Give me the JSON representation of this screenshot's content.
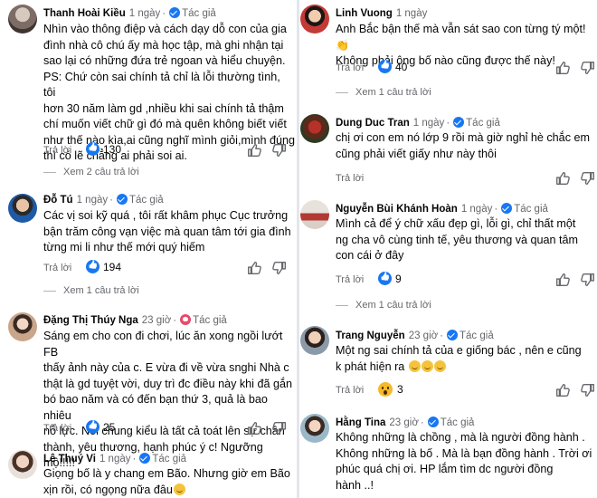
{
  "labels": {
    "reply": "Trả lời",
    "author_badge": "Tác giả"
  },
  "left": [
    {
      "name": "Thanh Hoài Kiều",
      "time": "1 ngày",
      "author": "Tác giả",
      "text": [
        "Nhìn vào thông điệp và cách dạy dỗ con của gia",
        "đình nhà cô chú ấy mà học tập, mà ghi nhận tại",
        "sao lại có những đứa trẻ ngoan và hiểu chuyện.",
        "PS: Chứ còn sai chính tả chỉ là lỗi thường tình, tôi",
        "hơn 30 năm làm gd ,nhiều khi sai chính tả thậm",
        "chí muốn viết chữ gì đó mà quên không biết viết",
        "như thế nào kìa,ai cũng nghĩ mình giỏi,mình đúng",
        "thì có lẽ chẳng ai phải soi ai."
      ],
      "reply": "Trả lời",
      "count": "130",
      "more": "Xem 2 câu trả lời"
    },
    {
      "name": "Đỗ Tú",
      "time": "1 ngày",
      "author": "Tác giả",
      "text": [
        "Các vị soi kỹ quá , tôi rất khâm phục Cục trưởng",
        "bận trăm công vạn việc mà quan tâm tới gia đình",
        "từng mi li như thế mới quý hiếm"
      ],
      "reply": "Trả lời",
      "count": "194",
      "more": "Xem 1 câu trả lời"
    },
    {
      "name": "Đặng Thị Thúy Nga",
      "time": "23 giờ",
      "author": "Tác giả",
      "text": [
        "Sáng em cho con đi chơi, lúc ăn xong ngồi lướt FB",
        "thấy ảnh này của c. E vừa đi về vừa snghi Nhà c",
        "thật là gd tuyệt vời, duy trì đc điều này khi đã gắn",
        "bó bao năm và có đến bạn thứ 3, quả là bao nhiêu",
        "nỗ lực. Nói chung kiểu là tất cả toát lên sự chân",
        "thành, yêu thương, hạnh phúc ý c! Ngưỡng mộ!!!!!"
      ],
      "reply": "Trả lời",
      "count": "25"
    },
    {
      "name": "Lê Thuý Vi",
      "time": "1 ngày",
      "author": "Tác giả",
      "text": [
        "Giọng bố là y chang em Bão. Nhưng giờ em Bão",
        "xịn rồi, có ngọng nữa đâu"
      ]
    }
  ],
  "right": [
    {
      "name": "Linh Vuong",
      "time": "1 ngày",
      "text": [
        "Anh Bắc bận thế mà vẫn sát sao con từng tý một!",
        "Không phải ông bố nào cũng được thế này!"
      ],
      "reply": "Trả lời",
      "count": "40",
      "more": "Xem 1 câu trả lời"
    },
    {
      "name": "Dung Duc Tran",
      "time": "1 ngày",
      "author": "Tác giả",
      "text": [
        "chị ơi con em nó lớp 9 rồi mà giờ nghỉ hè chắc em",
        "cũng phải viết giấy như này thôi"
      ],
      "reply": "Trả lời"
    },
    {
      "name": "Nguyễn Bùi Khánh Hoàn",
      "time": "1 ngày",
      "author": "Tác giả",
      "text": [
        "Mình cả để ý chữ xấu đẹp gì, lỗi gì, chỉ thất một",
        "ng cha vô cùng tinh tế, yêu thương và quan tâm",
        "con cái ở đây"
      ],
      "reply": "Trả lời",
      "count": "9",
      "more": "Xem 1 câu trả lời"
    },
    {
      "name": "Trang Nguyễn",
      "time": "23 giờ",
      "author": "Tác giả",
      "text": [
        "Một ng sai chính tả của e giống bác , nên e cũng",
        "k phát hiện ra"
      ],
      "reply": "Trả lời",
      "count": "3"
    },
    {
      "name": "Hằng Tina",
      "time": "23 giờ",
      "author": "Tác giả",
      "text": [
        "Không những là chồng , mà là người đồng hành .",
        "Không những là bố . Mà là bạn đồng hành . Trời ơi",
        "phúc quá chị ơi. HP lắm tìm dc người đồng",
        "hành ..!"
      ]
    }
  ],
  "colors": {
    "link_blue": "#1877f2",
    "secondary_text": "#65676b",
    "background_gap": "#e4e6ea"
  }
}
